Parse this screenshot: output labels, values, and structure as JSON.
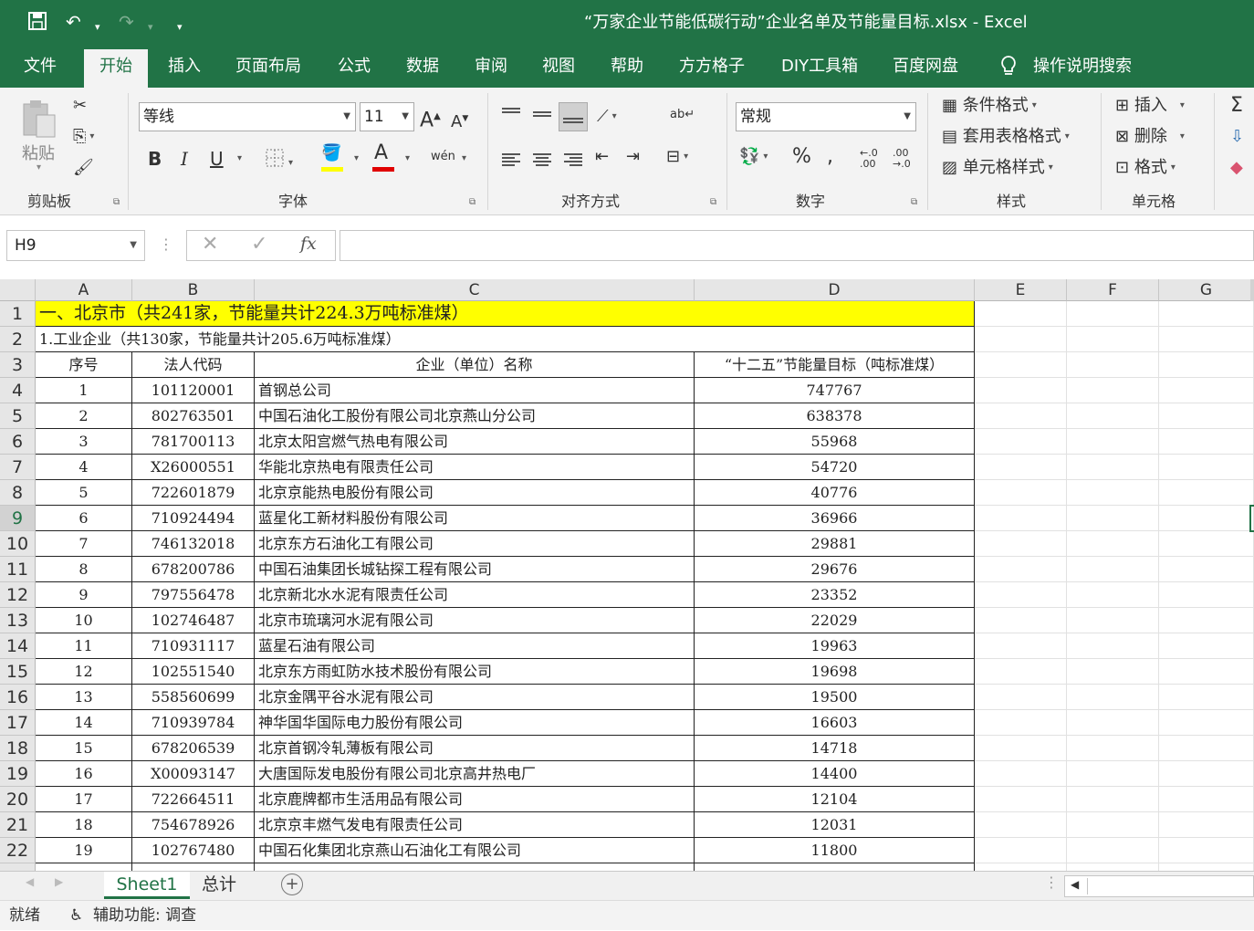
{
  "window": {
    "title": "“万家企业节能低碳行动”企业名单及节能量目标.xlsx  -  Excel"
  },
  "ribbon_tabs": [
    "文件",
    "开始",
    "插入",
    "页面布局",
    "公式",
    "数据",
    "审阅",
    "视图",
    "帮助",
    "方方格子",
    "DIY工具箱",
    "百度网盘",
    "操作说明搜索"
  ],
  "active_tab": "开始",
  "clipboard": {
    "paste_label": "粘贴",
    "group_label": "剪贴板"
  },
  "font": {
    "name": "等线",
    "size": "11",
    "bold": "B",
    "italic": "I",
    "underline": "U",
    "group_label": "字体",
    "fill_color": "#ffff00",
    "font_color": "#e00000"
  },
  "alignment": {
    "group_label": "对齐方式"
  },
  "number": {
    "format": "常规",
    "group_label": "数字"
  },
  "styles": {
    "conditional": "条件格式",
    "table": "套用表格格式",
    "cell_styles": "单元格样式",
    "group_label": "样式"
  },
  "cells_group": {
    "insert": "插入",
    "delete": "删除",
    "format": "格式",
    "group_label": "单元格"
  },
  "formula_bar": {
    "name_box": "H9",
    "fx": "fx",
    "content": ""
  },
  "columns": [
    "A",
    "B",
    "C",
    "D",
    "E",
    "F",
    "G"
  ],
  "rows": [
    {
      "n": "1",
      "merged": "一、北京市（共241家，节能量共计224.3万吨标准煤）"
    },
    {
      "n": "2",
      "merged": "1.工业企业（共130家，节能量共计205.6万吨标准煤）"
    },
    {
      "n": "3",
      "a": "序号",
      "b": "法人代码",
      "c": "企业（单位）名称",
      "d": "“十二五”节能量目标（吨标准煤）"
    },
    {
      "n": "4",
      "a": "1",
      "b": "101120001",
      "c": "首钢总公司",
      "d": "747767"
    },
    {
      "n": "5",
      "a": "2",
      "b": "802763501",
      "c": "中国石油化工股份有限公司北京燕山分公司",
      "d": "638378"
    },
    {
      "n": "6",
      "a": "3",
      "b": "781700113",
      "c": "北京太阳宫燃气热电有限公司",
      "d": "55968"
    },
    {
      "n": "7",
      "a": "4",
      "b": "X26000551",
      "c": "华能北京热电有限责任公司",
      "d": "54720"
    },
    {
      "n": "8",
      "a": "5",
      "b": "722601879",
      "c": "北京京能热电股份有限公司",
      "d": "40776"
    },
    {
      "n": "9",
      "a": "6",
      "b": "710924494",
      "c": "蓝星化工新材料股份有限公司",
      "d": "36966"
    },
    {
      "n": "10",
      "a": "7",
      "b": "746132018",
      "c": "北京东方石油化工有限公司",
      "d": "29881"
    },
    {
      "n": "11",
      "a": "8",
      "b": "678200786",
      "c": "中国石油集团长城钻探工程有限公司",
      "d": "29676"
    },
    {
      "n": "12",
      "a": "9",
      "b": "797556478",
      "c": "北京新北水水泥有限责任公司",
      "d": "23352"
    },
    {
      "n": "13",
      "a": "10",
      "b": "102746487",
      "c": "北京市琉璃河水泥有限公司",
      "d": "22029"
    },
    {
      "n": "14",
      "a": "11",
      "b": "710931117",
      "c": "蓝星石油有限公司",
      "d": "19963"
    },
    {
      "n": "15",
      "a": "12",
      "b": "102551540",
      "c": "北京东方雨虹防水技术股份有限公司",
      "d": "19698"
    },
    {
      "n": "16",
      "a": "13",
      "b": "558560699",
      "c": "北京金隅平谷水泥有限公司",
      "d": "19500"
    },
    {
      "n": "17",
      "a": "14",
      "b": "710939784",
      "c": "神华国华国际电力股份有限公司",
      "d": "16603"
    },
    {
      "n": "18",
      "a": "15",
      "b": "678206539",
      "c": "北京首钢冷轧薄板有限公司",
      "d": "14718"
    },
    {
      "n": "19",
      "a": "16",
      "b": "X00093147",
      "c": "大唐国际发电股份有限公司北京高井热电厂",
      "d": "14400"
    },
    {
      "n": "20",
      "a": "17",
      "b": "722664511",
      "c": "北京鹿牌都市生活用品有限公司",
      "d": "12104"
    },
    {
      "n": "21",
      "a": "18",
      "b": "754678926",
      "c": "北京京丰燃气发电有限责任公司",
      "d": "12031"
    },
    {
      "n": "22",
      "a": "19",
      "b": "102767480",
      "c": "中国石化集团北京燕山石油化工有限公司",
      "d": "11800"
    }
  ],
  "selected_row": "9",
  "sheet_tabs": [
    "Sheet1",
    "总计"
  ],
  "status": {
    "ready": "就绪",
    "accessibility": "辅助功能: 调查"
  },
  "colors": {
    "excel_green": "#217346",
    "header_fill": "#ffff00"
  }
}
